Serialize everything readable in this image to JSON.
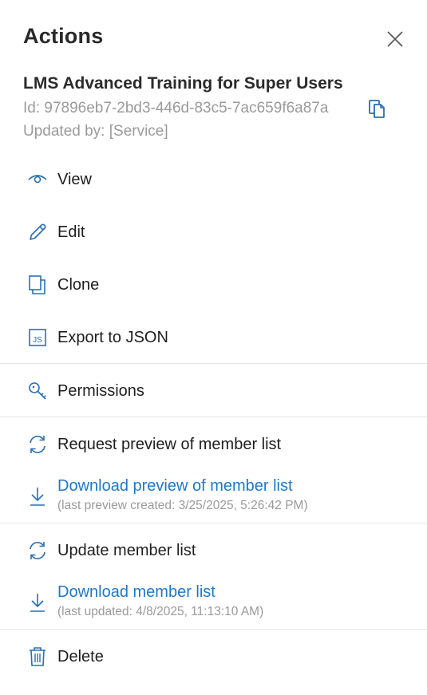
{
  "panel": {
    "title": "Actions",
    "object_name": "LMS Advanced Training for Super Users",
    "id_text": "Id: 97896eb7-2bd3-446d-83c5-7ac659f6a87a",
    "updated_by_text": "Updated by: [Service]"
  },
  "actions": {
    "view": {
      "label": "View",
      "icon": "eye-icon"
    },
    "edit": {
      "label": "Edit",
      "icon": "pencil-icon"
    },
    "clone": {
      "label": "Clone",
      "icon": "clone-icon"
    },
    "export_json": {
      "label": "Export to JSON",
      "icon": "json-file-icon"
    },
    "permissions": {
      "label": "Permissions",
      "icon": "key-icon"
    },
    "request_preview": {
      "label": "Request preview of member list",
      "icon": "refresh-icon"
    },
    "download_preview": {
      "label": "Download preview of member list",
      "sub": "(last preview created: 3/25/2025, 5:26:42 PM)",
      "icon": "download-icon"
    },
    "update_members": {
      "label": "Update member list",
      "icon": "refresh-icon"
    },
    "download_members": {
      "label": "Download member list",
      "sub": "(last updated: 4/8/2025, 11:13:10 AM)",
      "icon": "download-icon"
    },
    "delete": {
      "label": "Delete",
      "icon": "trash-icon"
    }
  },
  "colors": {
    "accent": "#1f78c8",
    "icon": "#2b6fb0",
    "muted_text": "#9a9a9a",
    "divider": "#e4e4e4"
  }
}
